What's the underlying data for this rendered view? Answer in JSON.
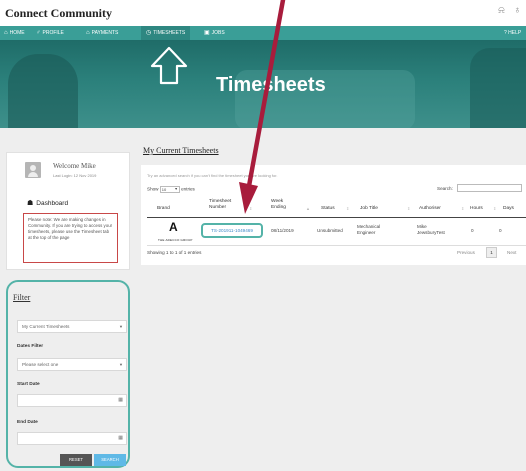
{
  "app": {
    "title": "Connect Community"
  },
  "topbar": {
    "icons": "⍾ ♁"
  },
  "nav": {
    "items": [
      {
        "icon": "⌂",
        "label": "HOME"
      },
      {
        "icon": "♂",
        "label": "PROFILE"
      },
      {
        "icon": "⌂",
        "label": "PAYMENTS"
      },
      {
        "icon": "◷",
        "label": "TIMESHEETS"
      },
      {
        "icon": "▣",
        "label": "JOBS"
      }
    ],
    "help": "? HELP"
  },
  "hero": {
    "title": "Timesheets"
  },
  "welcome": {
    "greeting": "Welcome Mike",
    "last_login": "Last Login: 12 Nov 2019",
    "dashboard": "Dashboard",
    "notice": "Please note: We are making changes in Community. If you are trying to access your timesheets, please use the Timesheet tab at the top of the page"
  },
  "filter": {
    "heading": "Filter",
    "type_value": "My Current Timesheets",
    "dates_label": "Dates Filter",
    "dates_value": "Please select one",
    "start_label": "Start Date",
    "end_label": "End Date",
    "reset": "RESET",
    "search": "SEARCH"
  },
  "main": {
    "title": "My Current Timesheets",
    "hint": "Try an advanced search if you can't find the timesheet you are looking for.",
    "show_prefix": "Show",
    "show_value": "10",
    "show_suffix": "entries",
    "search_label": "Search:",
    "columns": {
      "brand": "Brand",
      "timesheet_number": "Timesheet Number",
      "week_ending": "Week Ending",
      "status": "Status",
      "job_title": "Job Title",
      "authoriser": "Authoriser",
      "hours": "Hours",
      "days": "Days"
    },
    "row": {
      "brand_logo": "A",
      "brand_name": "THE ADECCO GROUP",
      "timesheet_number": "TS-201911-1049469",
      "week_ending": "08/11/2019",
      "status": "Unsubmitted",
      "job_title": "Mechanical Engineer",
      "authoriser": "Mike JewsburyTest",
      "hours": "0",
      "days": "0"
    },
    "entries_info": "Showing 1 to 1 of 1 entries",
    "pager": {
      "prev": "Previous",
      "current": "1",
      "next": "Next"
    }
  },
  "colors": {
    "teal_nav": "#3a9e97",
    "highlight": "#54b3a8",
    "arrow": "#a81c3c",
    "notice_border": "#c84848",
    "link": "#3d88c7",
    "search_btn": "#5fb9e6"
  }
}
